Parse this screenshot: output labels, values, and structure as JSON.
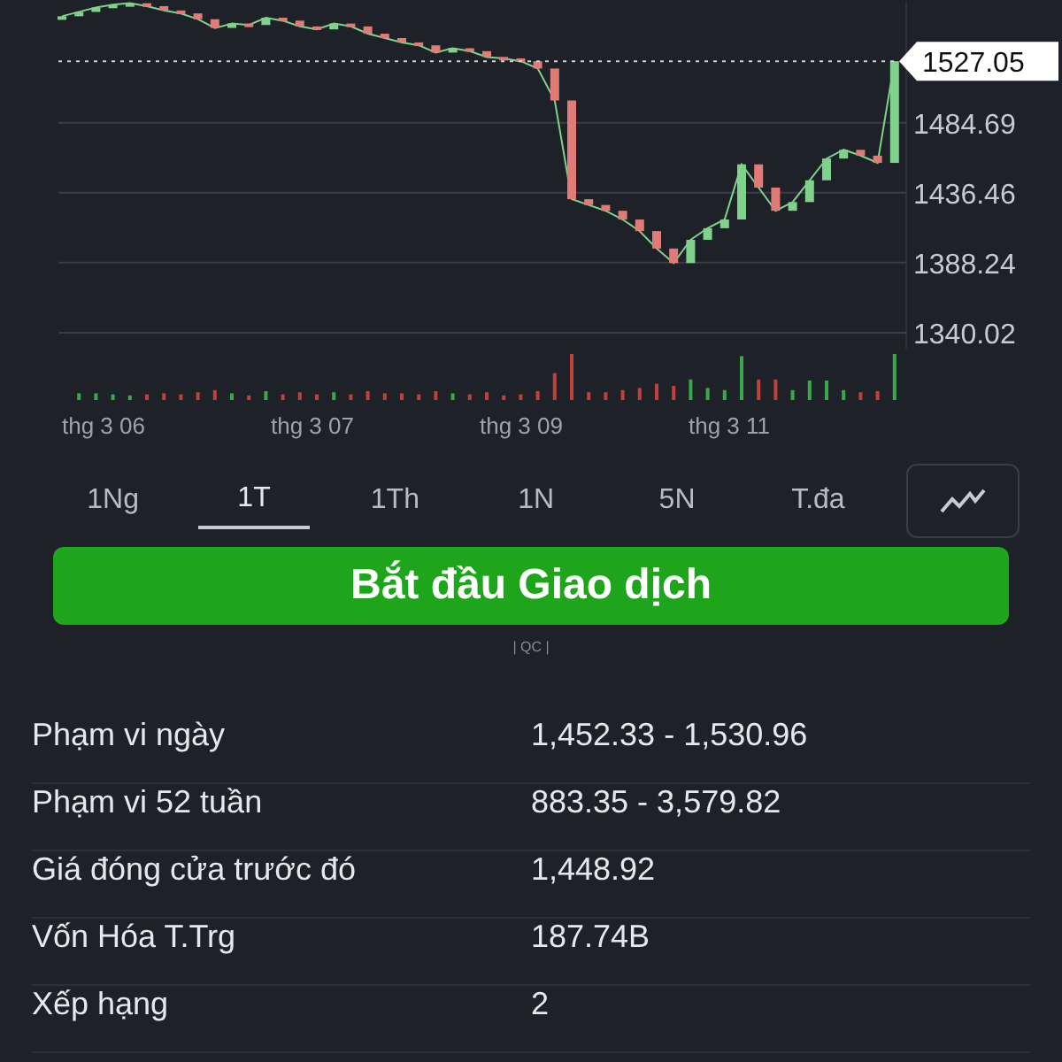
{
  "chart": {
    "current_price": "1527.05",
    "x_labels": [
      "thg 3 06",
      "thg 3 07",
      "thg 3 09",
      "thg 3 11"
    ],
    "chart_data": {
      "type": "line",
      "grid": true,
      "ylim": [
        1329,
        1568
      ],
      "yticks": [
        {
          "value": 1340.02,
          "label": "1340.02"
        },
        {
          "value": 1388.24,
          "label": "1388.24"
        },
        {
          "value": 1436.46,
          "label": "1436.46"
        },
        {
          "value": 1484.69,
          "label": "1484.69"
        }
      ],
      "series": [
        {
          "color": "#7fd18c",
          "values": [
            1558,
            1561,
            1564,
            1566,
            1567,
            1565,
            1562,
            1560,
            1556,
            1550,
            1553,
            1552,
            1557,
            1555,
            1551,
            1549,
            1553,
            1551,
            1546,
            1543,
            1540,
            1538,
            1533,
            1536,
            1534,
            1530,
            1529,
            1527,
            1522,
            1500,
            1432,
            1428,
            1424,
            1418,
            1410,
            1398,
            1388,
            1404,
            1412,
            1418,
            1456,
            1440,
            1424,
            1430,
            1445,
            1460,
            1466,
            1462,
            1457,
            1527
          ]
        }
      ]
    }
  },
  "ranges": [
    {
      "label": "1Ng",
      "selected": false
    },
    {
      "label": "1T",
      "selected": true
    },
    {
      "label": "1Th",
      "selected": false
    },
    {
      "label": "1N",
      "selected": false
    },
    {
      "label": "5N",
      "selected": false
    },
    {
      "label": "T.đa",
      "selected": false
    }
  ],
  "trade_button": "Bắt đầu Giao dịch",
  "ad_label": "| QC |",
  "stats": [
    {
      "label": "Phạm vi ngày",
      "value": "1,452.33 - 1,530.96"
    },
    {
      "label": "Phạm vi 52 tuần",
      "value": "883.35 - 3,579.82"
    },
    {
      "label": "Giá đóng cửa trước đó",
      "value": "1,448.92"
    },
    {
      "label": "Vốn Hóa T.Trg",
      "value": "187.74B"
    },
    {
      "label": "Xếp hạng",
      "value": "2"
    }
  ]
}
